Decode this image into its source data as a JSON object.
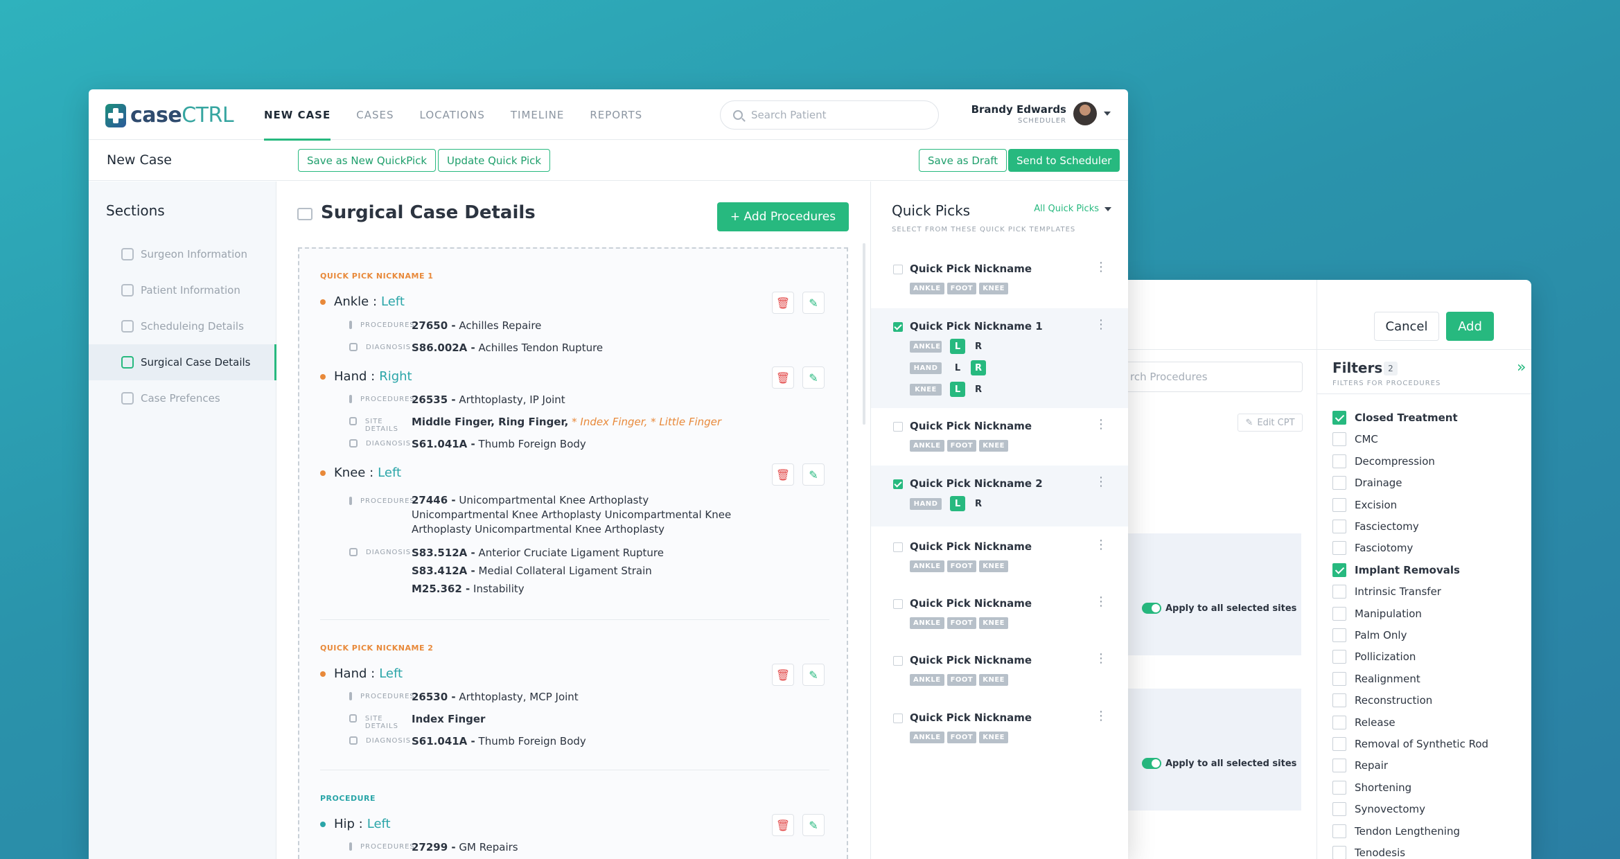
{
  "app": {
    "logo_a": "case",
    "logo_b": "CTRL"
  },
  "nav": [
    {
      "label": "NEW CASE"
    },
    {
      "label": "CASES"
    },
    {
      "label": "LOCATIONS"
    },
    {
      "label": "TIMELINE"
    },
    {
      "label": "REPORTS"
    }
  ],
  "search": {
    "placeholder": "Search Patient"
  },
  "user": {
    "name": "Brandy Edwards",
    "role": "SCHEDULER"
  },
  "subheader": {
    "title": "New Case",
    "save_quickpick": "Save as New QuickPick",
    "update_quickpick": "Update Quick Pick",
    "save_draft": "Save as Draft",
    "send": "Send to Scheduler"
  },
  "sections": {
    "title": "Sections",
    "items": [
      {
        "label": "Surgeon Information"
      },
      {
        "label": "Patient Information"
      },
      {
        "label": "Scheduleing Details"
      },
      {
        "label": "Surgical Case Details"
      },
      {
        "label": "Case Prefences"
      }
    ]
  },
  "main": {
    "title": "Surgical Case Details",
    "add_procedures": "+ Add Procedures"
  },
  "labels": {
    "procedures": "PROCEDURES",
    "diagnosis": "DIAGNOSIS",
    "site_details": "SITE DETAILS"
  },
  "groups": [
    {
      "name": "QUICK PICK NICKNAME 1",
      "sites": [
        {
          "part": "Ankle :",
          "side": "Left",
          "proc_code": "27650 -",
          "proc": "Achilles Repaire",
          "diag": [
            {
              "code": "S86.002A -",
              "text": "Achilles Tendon Rupture"
            }
          ]
        },
        {
          "part": "Hand :",
          "side": "Right",
          "proc_code": "26535 -",
          "proc": "Arthtoplasty, IP Joint",
          "site_details": "Middle Finger, Ring Finger,",
          "site_extra": " * Index Finger, * Little Finger",
          "diag": [
            {
              "code": "S61.041A -",
              "text": "Thumb Foreign Body"
            }
          ]
        },
        {
          "part": "Knee :",
          "side": "Left",
          "proc_code": "27446 -",
          "proc": "Unicompartmental Knee Arthoplasty Unicompartmental Knee Arthoplasty Unicompartmental Knee Arthoplasty Unicompartmental Knee Arthoplasty",
          "diag": [
            {
              "code": "S83.512A -",
              "text": "Anterior Cruciate Ligament Rupture"
            },
            {
              "code": "S83.412A -",
              "text": "Medial Collateral Ligament Strain"
            },
            {
              "code": "M25.362 -",
              "text": "Instability"
            }
          ]
        }
      ]
    },
    {
      "name": "QUICK PICK NICKNAME 2",
      "sites": [
        {
          "part": "Hand :",
          "side": "Left",
          "proc_code": "26530 -",
          "proc": "Arthtoplasty, MCP Joint",
          "site_details": "Index Finger",
          "diag": [
            {
              "code": "S61.041A -",
              "text": "Thumb Foreign Body"
            }
          ]
        }
      ]
    },
    {
      "name": "PROCEDURE",
      "sites": [
        {
          "part": "Hip :",
          "side": "Left",
          "proc_code": "27299 -",
          "proc": "GM Repairs"
        }
      ]
    }
  ],
  "quickpicks": {
    "title": "Quick Picks",
    "subtitle": "SELECT FROM THESE QUICK PICK TEMPLATES",
    "filter": "All Quick Picks",
    "cards": [
      {
        "name": "Quick Pick Nickname",
        "checked": false,
        "tags": [
          "ANKLE",
          "FOOT",
          "KNEE"
        ]
      },
      {
        "name": "Quick Pick Nickname 1",
        "checked": true,
        "rows": [
          {
            "tag": "ANKLE",
            "l": "L",
            "r": "R",
            "sel": "L"
          },
          {
            "tag": "HAND",
            "l": "L",
            "r": "R",
            "sel": "R"
          },
          {
            "tag": "KNEE",
            "l": "L",
            "r": "R",
            "sel": "L"
          }
        ]
      },
      {
        "name": "Quick Pick Nickname",
        "checked": false,
        "tags": [
          "ANKLE",
          "FOOT",
          "KNEE"
        ]
      },
      {
        "name": "Quick Pick Nickname 2",
        "checked": true,
        "rows": [
          {
            "tag": "HAND",
            "l": "L",
            "r": "R",
            "sel": "L"
          }
        ]
      },
      {
        "name": "Quick Pick Nickname",
        "checked": false,
        "tags": [
          "ANKLE",
          "FOOT",
          "KNEE"
        ]
      },
      {
        "name": "Quick Pick Nickname",
        "checked": false,
        "tags": [
          "ANKLE",
          "FOOT",
          "KNEE"
        ]
      },
      {
        "name": "Quick Pick Nickname",
        "checked": false,
        "tags": [
          "ANKLE",
          "FOOT",
          "KNEE"
        ]
      },
      {
        "name": "Quick Pick Nickname",
        "checked": false,
        "tags": [
          "ANKLE",
          "FOOT",
          "KNEE"
        ]
      }
    ]
  },
  "dialog": {
    "cancel": "Cancel",
    "add": "Add",
    "search_placeholder": "Search Procedures",
    "search_visible": "rch Procedures",
    "edit_cpt": "Edit CPT",
    "apply_all": "Apply to all selected sites"
  },
  "filters": {
    "title": "Filters",
    "count": "2",
    "subtitle": "FILTERS FOR PROCEDURES",
    "items": [
      {
        "label": "Closed Treatment",
        "checked": true
      },
      {
        "label": "CMC",
        "checked": false
      },
      {
        "label": "Decompression",
        "checked": false
      },
      {
        "label": "Drainage",
        "checked": false
      },
      {
        "label": "Excision",
        "checked": false
      },
      {
        "label": "Fasciectomy",
        "checked": false
      },
      {
        "label": "Fasciotomy",
        "checked": false
      },
      {
        "label": "Implant Removals",
        "checked": true
      },
      {
        "label": "Intrinsic Transfer",
        "checked": false
      },
      {
        "label": "Manipulation",
        "checked": false
      },
      {
        "label": "Palm Only",
        "checked": false
      },
      {
        "label": "Pollicization",
        "checked": false
      },
      {
        "label": "Realignment",
        "checked": false
      },
      {
        "label": "Reconstruction",
        "checked": false
      },
      {
        "label": "Release",
        "checked": false
      },
      {
        "label": "Removal of Synthetic Rod",
        "checked": false
      },
      {
        "label": "Repair",
        "checked": false
      },
      {
        "label": "Shortening",
        "checked": false
      },
      {
        "label": "Synovectomy",
        "checked": false
      },
      {
        "label": "Tendon Lengthening",
        "checked": false
      },
      {
        "label": "Tenodesis",
        "checked": false
      }
    ]
  },
  "colors": {
    "accent": "#27b97f",
    "orange": "#e8893a",
    "teal": "#2aa5a8",
    "bg": "#2a93ab"
  }
}
